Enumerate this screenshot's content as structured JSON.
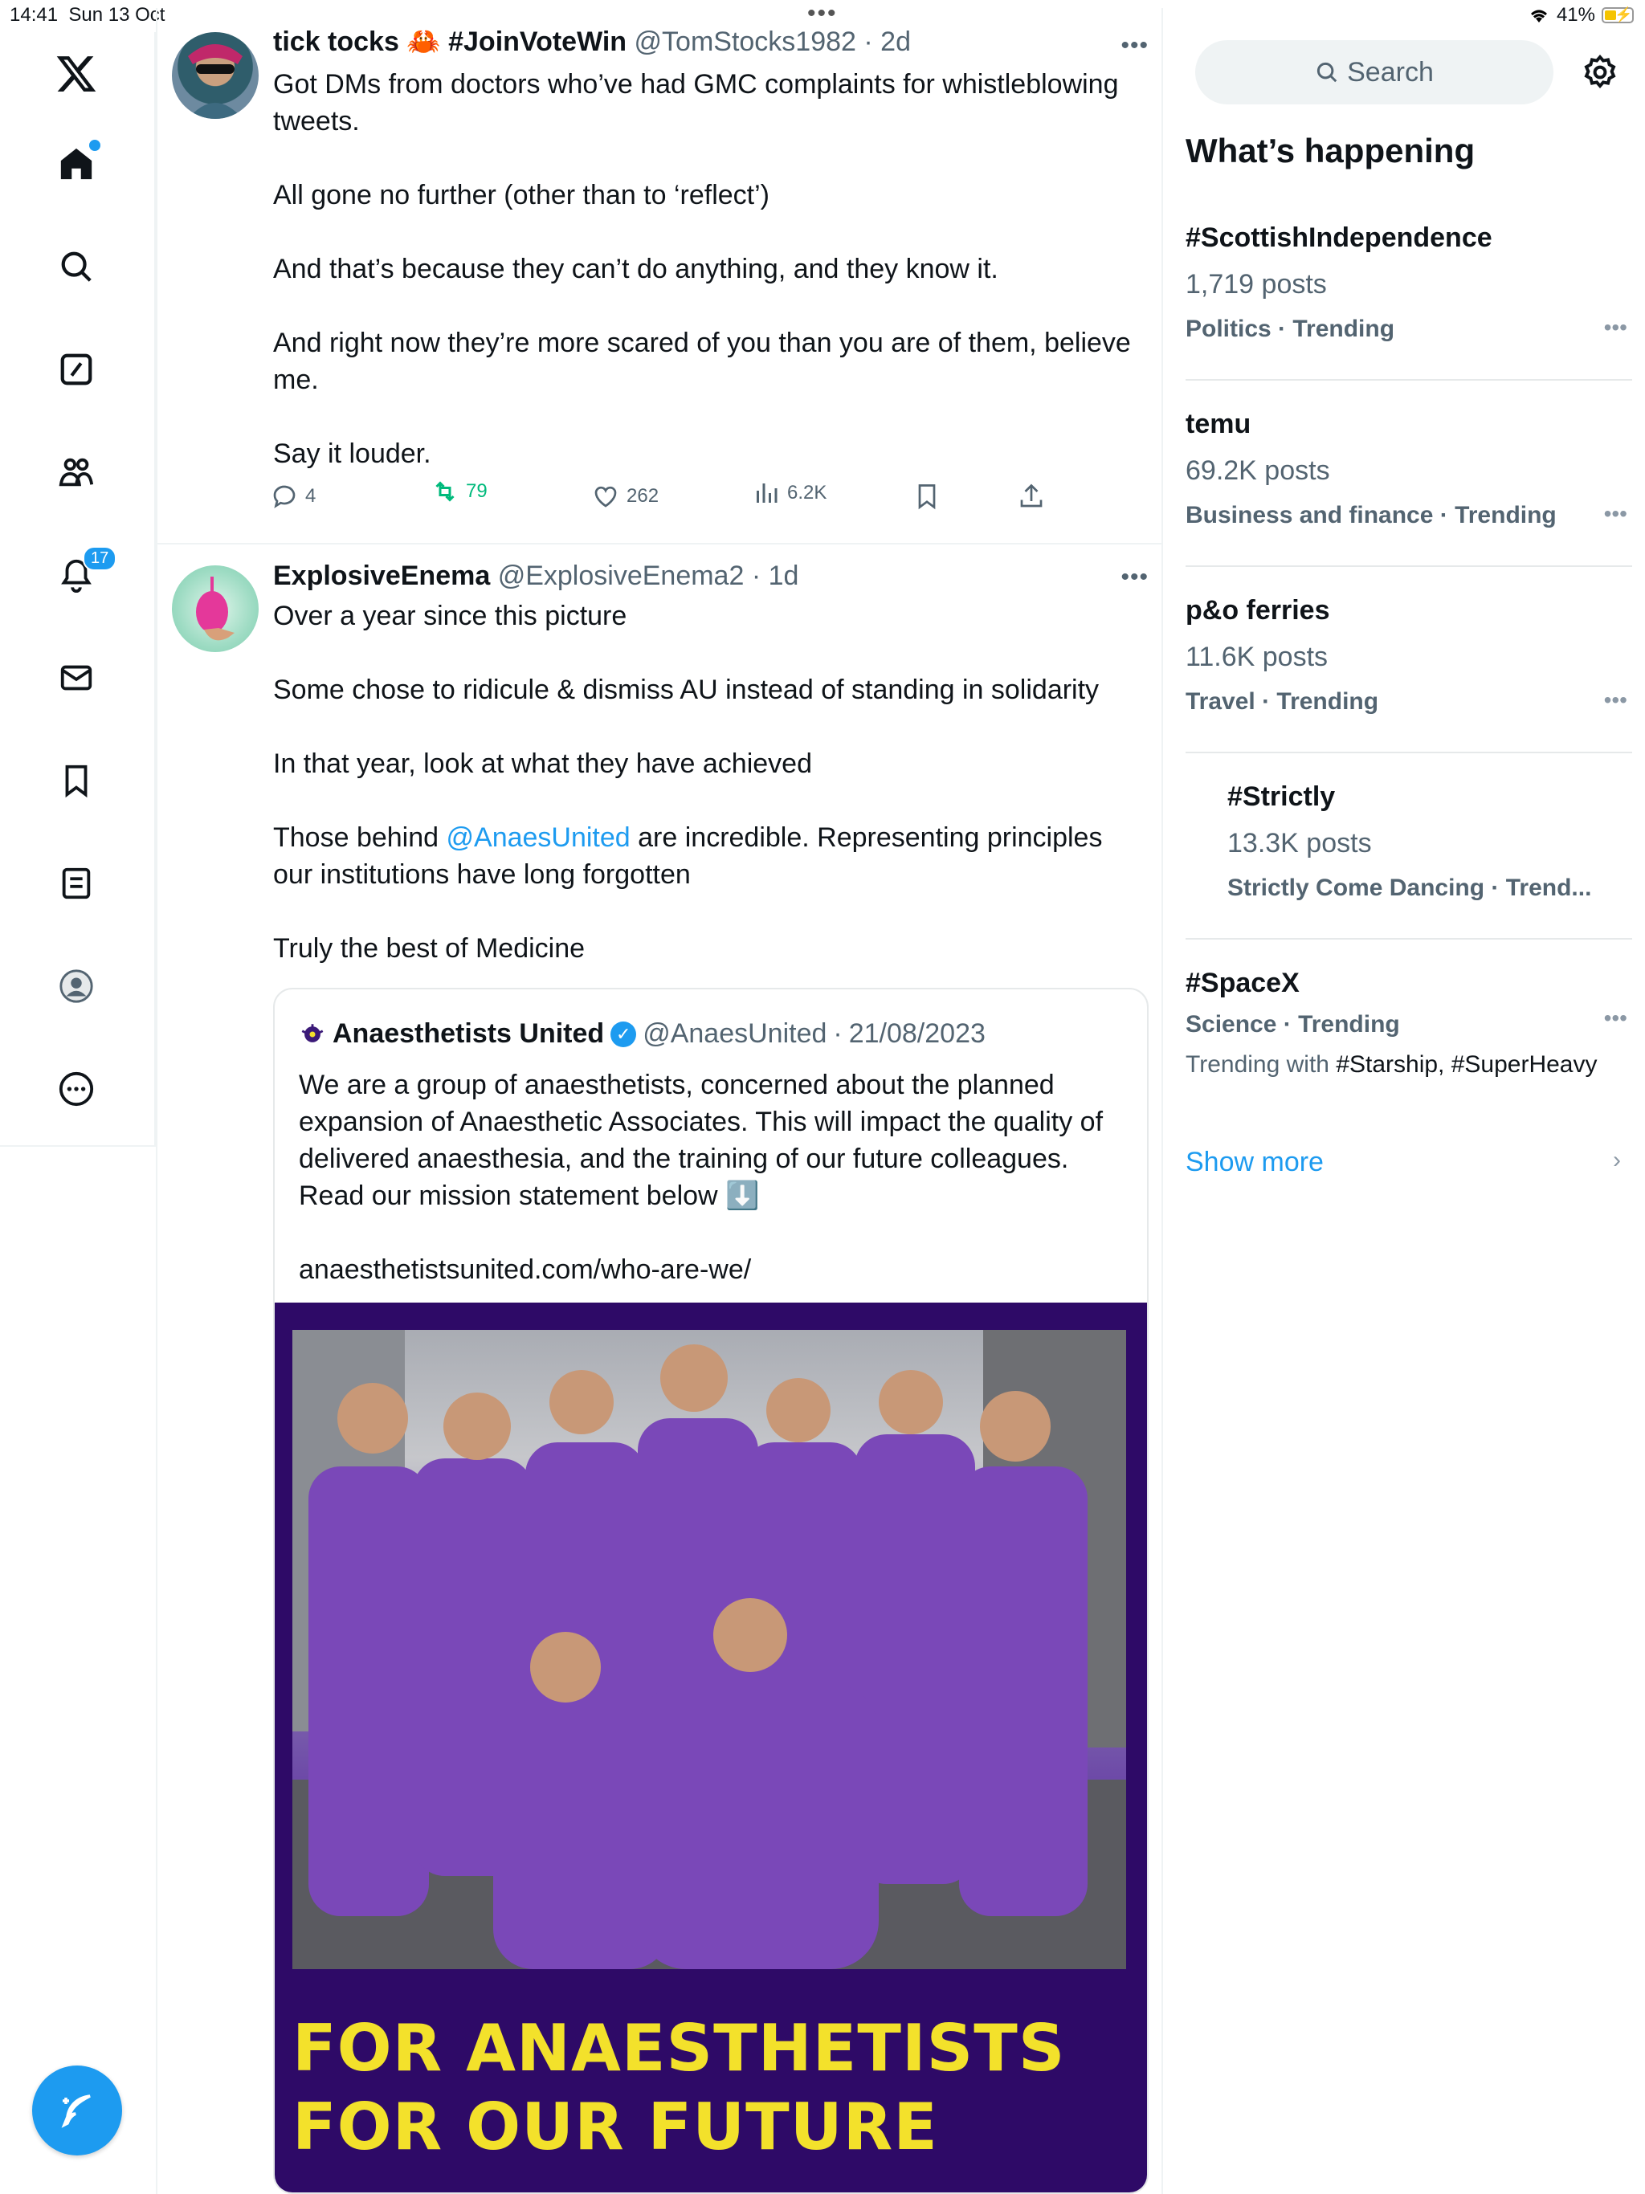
{
  "status": {
    "time": "14:41",
    "date": "Sun 13 Oct",
    "battery": "41%"
  },
  "nav": {
    "notifications_badge": "17"
  },
  "tweets": [
    {
      "name": "tick tocks",
      "emoji": "🦀",
      "hashtag": "#JoinVoteWin",
      "handle": "@TomStocks1982",
      "time": "2d",
      "paragraphs": [
        "Got DMs from doctors who’ve had GMC complaints for whistleblowing tweets.",
        "All gone no further (other than to ‘reflect’)",
        "And that’s because they can’t do anything, and they know it.",
        "And right now they’re more scared of you than you are of them, believe me.",
        "Say it louder."
      ],
      "replies": "4",
      "retweets": "79",
      "likes": "262",
      "views": "6.2K"
    },
    {
      "name": "ExplosiveEnema",
      "handle": "@ExplosiveEnema2",
      "time": "1d",
      "p1": "Over a year since this picture",
      "p2": "Some chose to ridicule & dismiss AU instead of standing in solidarity",
      "p3": "In that year, look at what they have achieved",
      "p4_pre": "Those behind ",
      "p4_link": "@AnaesUnited",
      "p4_post": " are incredible. Representing principles our institutions have long forgotten",
      "p5": "Truly the best of Medicine",
      "quote": {
        "name": "Anaesthetists United",
        "handle": "@AnaesUnited",
        "date": "21/08/2023",
        "text": "We are a group of anaesthetists, concerned about the planned expansion of Anaesthetic Associates. This will impact the quality of delivered anaesthesia, and the training of our future colleagues. Read our mission statement below ⬇️",
        "url": "anaesthetistsunited.com/who-are-we/",
        "poster_line1": "FOR ANAESTHETISTS",
        "poster_line2": "FOR OUR FUTURE"
      }
    }
  ],
  "sidebar": {
    "search_placeholder": "Search",
    "title": "What’s happening",
    "trends": [
      {
        "name": "#ScottishIndependence",
        "count": "1,719 posts",
        "category": "Politics · Trending"
      },
      {
        "name": "temu",
        "count": "69.2K posts",
        "category": "Business and finance · Trending"
      },
      {
        "name": "p&o ferries",
        "count": "11.6K posts",
        "category": "Travel · Trending"
      },
      {
        "name": "#Strictly",
        "count": "13.3K posts",
        "category": "Strictly Come Dancing · Trend..."
      },
      {
        "name": "#SpaceX",
        "category": "Science · Trending",
        "with_label": "Trending with ",
        "with_tags": "#Starship, #SuperHeavy"
      }
    ],
    "show_more": "Show more"
  }
}
